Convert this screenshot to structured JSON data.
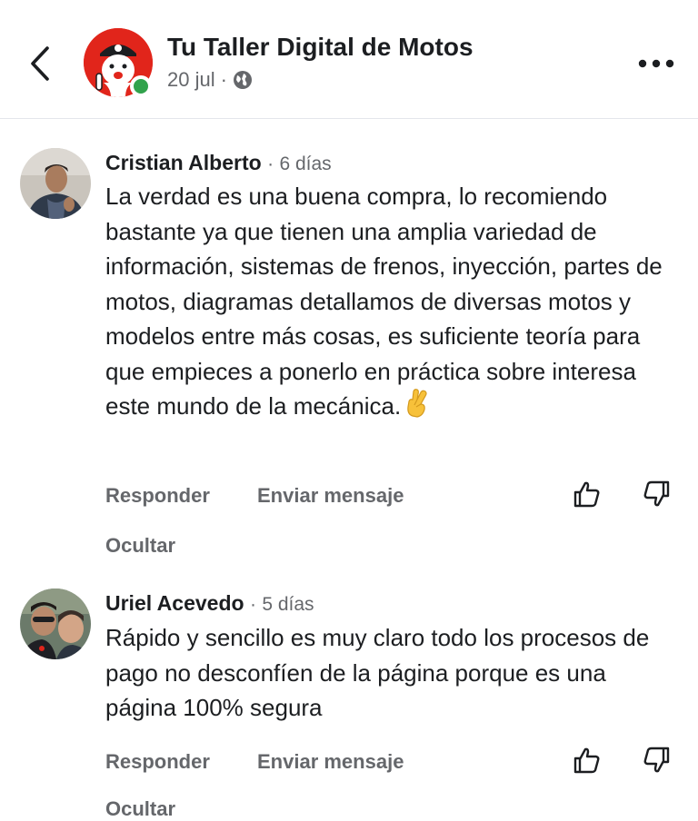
{
  "header": {
    "page_name": "Tu Taller Digital de Motos",
    "date": "20 jul",
    "separator": "·",
    "icons": {
      "back": "chevron-left-icon",
      "privacy": "globe-icon",
      "more": "more-horizontal-icon"
    }
  },
  "comments": [
    {
      "author": "Cristian Alberto",
      "separator": "·",
      "time": "6 días",
      "text": "La verdad es una buena compra, lo recomiendo bastante ya que tienen una amplia variedad de información, sistemas de frenos, inyección, partes de motos, diagramas detallamos de diversas motos y modelos entre más cosas, es suficiente teoría para que empieces a ponerlo en práctica sobre interesa este mundo de la mecánica.",
      "emoji": "crossed-fingers",
      "reply_label": "Responder",
      "message_label": "Enviar mensaje",
      "hide_label": "Ocultar"
    },
    {
      "author": "Uriel Acevedo",
      "separator": "·",
      "time": "5 días",
      "text": "Rápido y sencillo es muy claro todo los procesos de pago no desconfíen de la página porque es una página 100% segura",
      "reply_label": "Responder",
      "message_label": "Enviar mensaje",
      "hide_label": "Ocultar"
    }
  ],
  "colors": {
    "text": "#1c1e21",
    "secondary": "#65676b",
    "brand_red": "#e1251b",
    "online": "#31a24c"
  }
}
